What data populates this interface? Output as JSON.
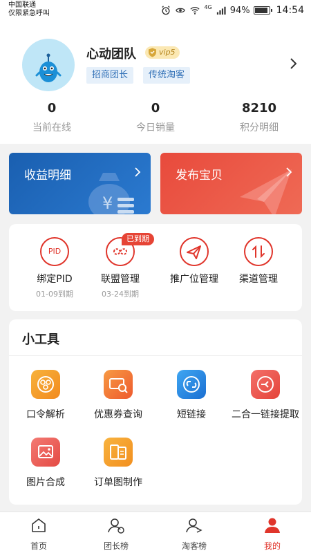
{
  "status": {
    "carrier": "中国联通",
    "emergency": "仅限紧急呼叫",
    "network": "4G",
    "battery": "94%",
    "time": "14:54"
  },
  "profile": {
    "name": "心动团队",
    "vip": "vip5",
    "tags": [
      "招商团长",
      "传统淘客"
    ]
  },
  "stats": [
    {
      "value": "0",
      "label": "当前在线"
    },
    {
      "value": "0",
      "label": "今日销量"
    },
    {
      "value": "8210",
      "label": "积分明细"
    }
  ],
  "banners": {
    "income": "收益明细",
    "publish": "发布宝贝"
  },
  "colors": {
    "accent": "#e0352b",
    "income_banner": "#1f66b8",
    "publish_banner": "#e8443a"
  },
  "quick": [
    {
      "label": "绑定PID",
      "sub": "01-09到期",
      "icon": "pid-icon"
    },
    {
      "label": "联盟管理",
      "sub": "03-24到期",
      "icon": "infinity-icon",
      "badge": "已到期"
    },
    {
      "label": "推广位管理",
      "sub": "",
      "icon": "paper-plane-icon"
    },
    {
      "label": "渠道管理",
      "sub": "",
      "icon": "swap-arrows-icon"
    }
  ],
  "tools": {
    "title": "小工具",
    "items": [
      {
        "label": "口令解析",
        "icon": "token-parse-icon"
      },
      {
        "label": "优惠券查询",
        "icon": "coupon-search-icon"
      },
      {
        "label": "短链接",
        "icon": "short-link-icon"
      },
      {
        "label": "二合一链接提取",
        "icon": "merge-link-icon"
      },
      {
        "label": "图片合成",
        "icon": "image-compose-icon"
      },
      {
        "label": "订单图制作",
        "icon": "order-image-icon"
      }
    ]
  },
  "nav": [
    {
      "label": "首页",
      "icon": "home-icon"
    },
    {
      "label": "团长榜",
      "icon": "leader-rank-icon"
    },
    {
      "label": "淘客榜",
      "icon": "taoke-rank-icon"
    },
    {
      "label": "我的",
      "icon": "profile-icon",
      "active": true
    }
  ]
}
